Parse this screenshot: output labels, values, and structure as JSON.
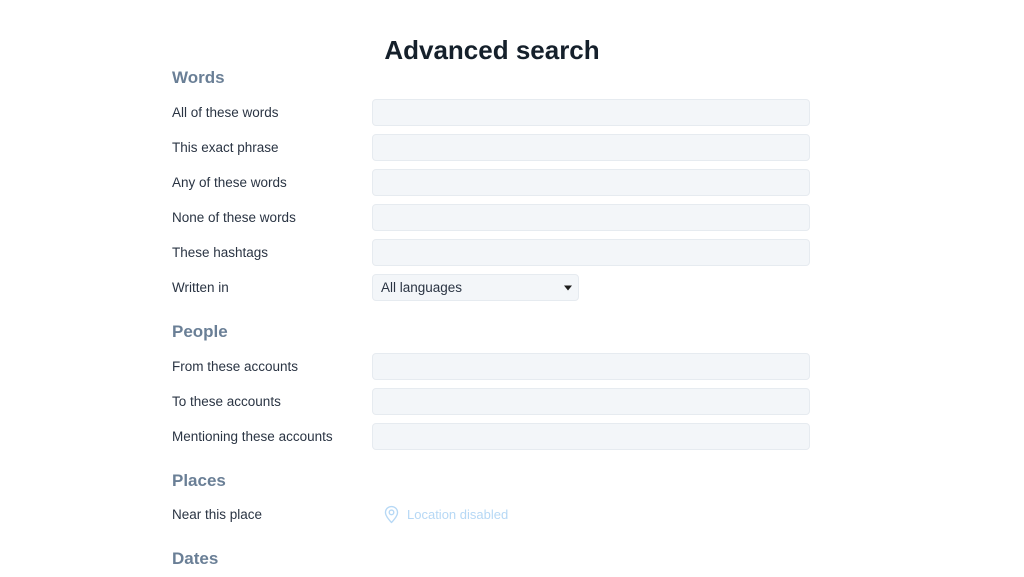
{
  "page": {
    "title": "Advanced search"
  },
  "colors": {
    "title": "#15202b",
    "section_heading": "#6a7f96",
    "label": "#2a3443",
    "input_background": "#f3f6f9",
    "input_border": "#e6ebf0",
    "location_disabled": "#b6d8f5"
  },
  "sections": [
    {
      "id": "words",
      "heading": "Words",
      "rows": [
        {
          "id": "all-of-these-words",
          "label": "All of these words",
          "type": "text",
          "value": "",
          "placeholder": ""
        },
        {
          "id": "this-exact-phrase",
          "label": "This exact phrase",
          "type": "text",
          "value": "",
          "placeholder": ""
        },
        {
          "id": "any-of-these-words",
          "label": "Any of these words",
          "type": "text",
          "value": "",
          "placeholder": ""
        },
        {
          "id": "none-of-these-words",
          "label": "None of these words",
          "type": "text",
          "value": "",
          "placeholder": ""
        },
        {
          "id": "these-hashtags",
          "label": "These hashtags",
          "type": "text",
          "value": "",
          "placeholder": ""
        },
        {
          "id": "written-in",
          "label": "Written in",
          "type": "select",
          "value": "All languages",
          "options": [
            "All languages"
          ]
        }
      ]
    },
    {
      "id": "people",
      "heading": "People",
      "rows": [
        {
          "id": "from-these-accounts",
          "label": "From these accounts",
          "type": "text",
          "value": "",
          "placeholder": ""
        },
        {
          "id": "to-these-accounts",
          "label": "To these accounts",
          "type": "text",
          "value": "",
          "placeholder": ""
        },
        {
          "id": "mentioning-these-accounts",
          "label": "Mentioning these accounts",
          "type": "text",
          "value": "",
          "placeholder": ""
        }
      ]
    },
    {
      "id": "places",
      "heading": "Places",
      "rows": [
        {
          "id": "near-this-place",
          "label": "Near this place",
          "type": "location",
          "value": "Location disabled",
          "icon": "location-pin-icon"
        }
      ]
    },
    {
      "id": "dates",
      "heading": "Dates",
      "rows": []
    }
  ]
}
